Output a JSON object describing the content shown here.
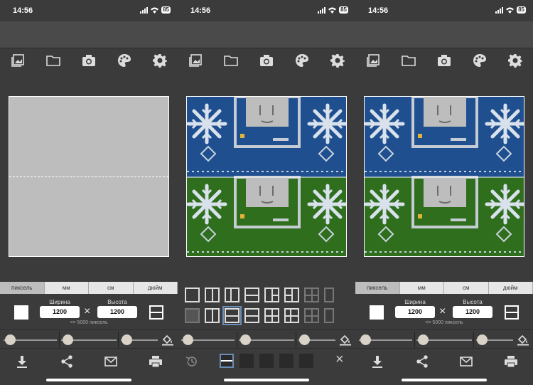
{
  "status": {
    "time": "14:56",
    "battery": "85"
  },
  "toolbar": {
    "icons": [
      "gallery-icon",
      "folder-icon",
      "camera-icon",
      "palette-icon",
      "gear-icon"
    ]
  },
  "units": {
    "items": [
      "пиксель",
      "мм",
      "см",
      "дюйм"
    ],
    "selected": "пиксель"
  },
  "size": {
    "width_label": "Ширина",
    "height_label": "Высота",
    "width_value": "1200",
    "height_value": "1200",
    "times": "×",
    "limit": "<= 5000 пиксель"
  },
  "bottom": {
    "icons": [
      "download-icon",
      "share-icon",
      "mail-icon",
      "print-icon"
    ]
  },
  "history": {
    "close": "×"
  },
  "colors": {
    "background": "#3b3b3b",
    "blue_knit": "#1f4f8f",
    "green_knit": "#2f6e1d",
    "selection": "#6a8db7"
  }
}
